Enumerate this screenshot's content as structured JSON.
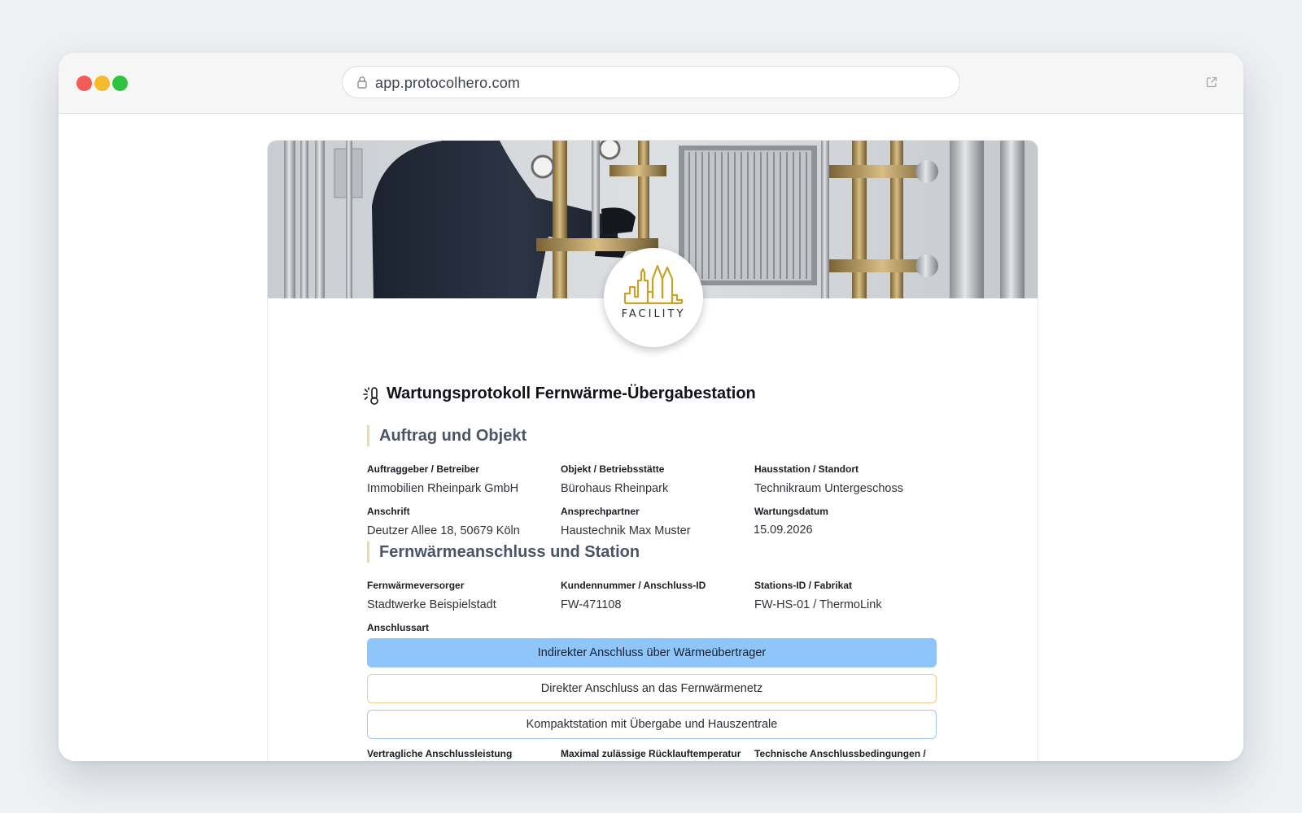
{
  "browser": {
    "url": "app.protocolhero.com"
  },
  "logo": {
    "text": "FACILITY"
  },
  "form": {
    "title": "Wartungsprotokoll Fernwärme-Übergabestation",
    "sections": [
      {
        "heading": "Auftrag und Objekt",
        "fields": [
          {
            "label": "Auftraggeber / Betreiber",
            "value": "Immobilien Rheinpark GmbH"
          },
          {
            "label": "Objekt / Betriebsstätte",
            "value": "Bürohaus Rheinpark"
          },
          {
            "label": "Hausstation / Standort",
            "value": "Technikraum Untergeschoss"
          },
          {
            "label": "Anschrift",
            "value": "Deutzer Allee 18, 50679 Köln"
          },
          {
            "label": "Ansprechpartner",
            "value": "Haustechnik Max Muster"
          },
          {
            "label": "Wartungsdatum",
            "value": "15.09.2026"
          }
        ]
      },
      {
        "heading": "Fernwärmeanschluss und Station",
        "fields": [
          {
            "label": "Fernwärmeversorger",
            "value": "Stadtwerke Beispielstadt"
          },
          {
            "label": "Kundennummer / Anschluss-ID",
            "value": "FW-471108"
          },
          {
            "label": "Stations-ID / Fabrikat",
            "value": "FW-HS-01 / ThermoLink"
          }
        ],
        "connection_type": {
          "label": "Anschlussart",
          "options": [
            "Indirekter Anschluss über Wärmeübertrager",
            "Direkter Anschluss an das Fernwärmenetz",
            "Kompaktstation mit Übergabe und Hauszentrale"
          ],
          "selected": "Indirekter Anschluss über Wärmeübertrager"
        },
        "next_labels": [
          "Vertragliche Anschlussleistung",
          "Maximal zulässige Rücklauftemperatur",
          "Technische Anschlussbedingungen /"
        ]
      }
    ]
  },
  "colors": {
    "selected_option": "#8ec5fa",
    "section_accent": "#ecd9a8",
    "logo_gold": "#c9a227"
  }
}
